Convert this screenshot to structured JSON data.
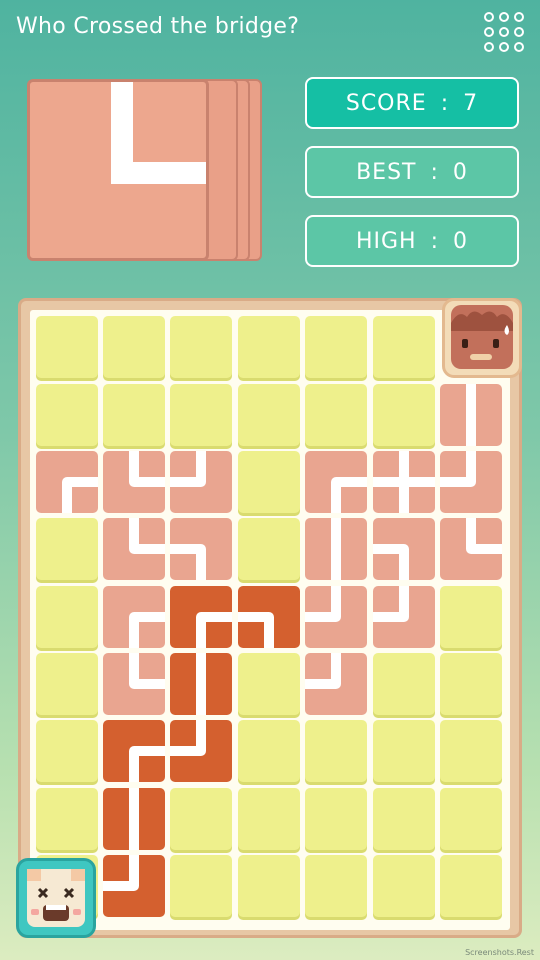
{
  "header": {
    "title": "Who Crossed the bridge?",
    "menu_icon": "grid-menu-icon"
  },
  "scores": {
    "score_label": "SCORE",
    "score_value": "7",
    "best_label": "BEST",
    "best_value": "0",
    "high_label": "HIGH",
    "high_value": "0"
  },
  "colors": {
    "empty_tile": "#eef08c",
    "pipe_tile": "#e9a590",
    "active_pipe_tile": "#d4602f",
    "score_bg": "#15bfa4"
  },
  "characters": {
    "top": "sweating-face-character",
    "bottom": "goal-character"
  },
  "watermark": "Screenshots.Rest"
}
